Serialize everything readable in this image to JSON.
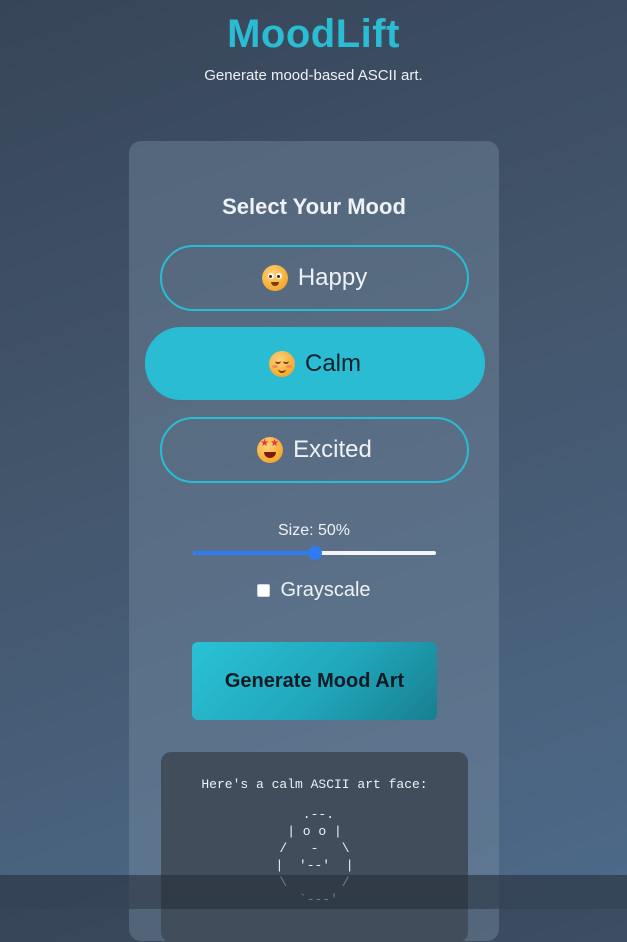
{
  "app": {
    "title": "MoodLift",
    "subtitle": "Generate mood-based ASCII art."
  },
  "mood_selector": {
    "heading": "Select Your Mood",
    "selected": "Calm",
    "options": [
      {
        "label": "Happy",
        "icon": "happy-face-emoji-icon"
      },
      {
        "label": "Calm",
        "icon": "relieved-face-emoji-icon"
      },
      {
        "label": "Excited",
        "icon": "star-struck-emoji-icon"
      }
    ]
  },
  "controls": {
    "size_label": "Size: 50%",
    "size_value": 0.5,
    "grayscale_label": "Grayscale",
    "grayscale_checked": false,
    "generate_label": "Generate Mood Art"
  },
  "output": {
    "caption": "Here's a calm ASCII art face:",
    "ascii_art": " .--.\n| o o |\n/   -   \\\n|  '--'  |\n\\       /\n `---'"
  },
  "colors": {
    "accent": "#29bcd3",
    "slider": "#2f7bf0"
  }
}
